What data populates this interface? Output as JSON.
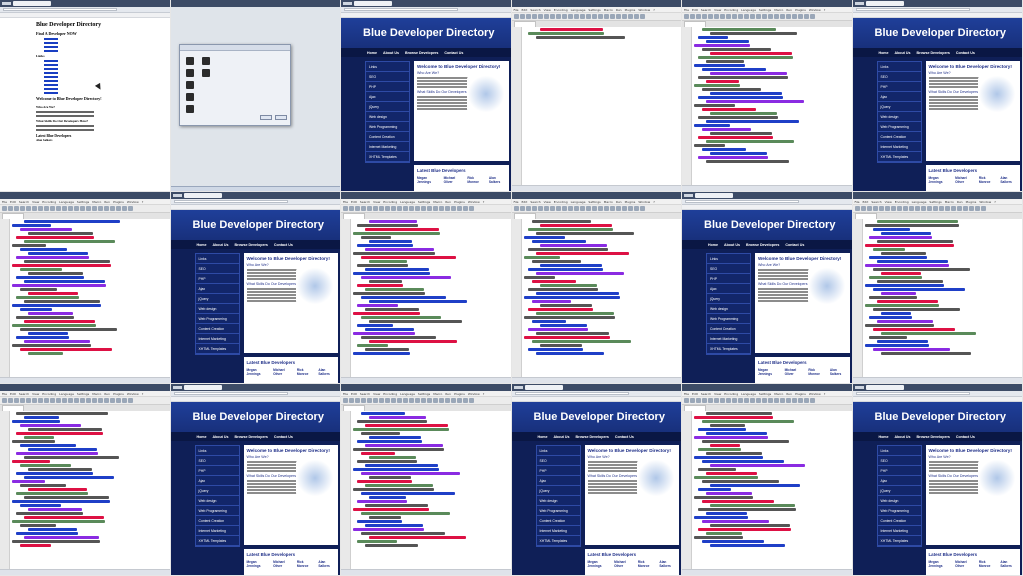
{
  "editor_menu": [
    "File",
    "Edit",
    "Search",
    "View",
    "Encoding",
    "Language",
    "Settings",
    "Macro",
    "Run",
    "Plugins",
    "Window",
    "?"
  ],
  "browser_tab": "Blue Developer Directory",
  "plain_page": {
    "title": "Blue Developer Directory",
    "find": "Find A Developer NOW",
    "links_heading": "Links",
    "welcome": "Welcome to Blue Developer Directory!",
    "who": "Who Are We?",
    "what_skills": "What Skills Do Our Developers Have?",
    "latest": "Latest Blue Developers",
    "dev_name": "Alan Salkers"
  },
  "site": {
    "title": "Blue Developer Directory",
    "find": "Find A Developer NOW",
    "nav": [
      "Home",
      "About Us",
      "Browse Developers",
      "Contact Us"
    ],
    "links_heading": "Links",
    "links": [
      "SEO",
      "PHP",
      "Ajax",
      "jQuery",
      "Web design",
      "Web Programming",
      "Content Creation",
      "Internet Marketing",
      "XHTML Templates"
    ],
    "welcome": "Welcome to Blue Developer Directory!",
    "who": "Who Are We?",
    "what_skills": "What Skills Do Our Developers Have?",
    "latest": "Latest Blue Developers",
    "developers": [
      "Megan Jennings",
      "Michael Oliver",
      "Rick Monroe",
      "Alan Salkers"
    ]
  }
}
